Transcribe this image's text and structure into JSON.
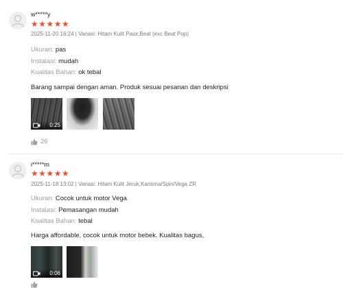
{
  "reviews": [
    {
      "username": "w*****y",
      "stars": "★★★★★",
      "meta": "2025-11-20 16:24 | Variasi: Hitam Kulit Pasir,Beat (exc Beat Pop)",
      "attributes": [
        {
          "key": "Ukuran: ",
          "value": "pas"
        },
        {
          "key": "Instalasi: ",
          "value": "mudah"
        },
        {
          "key": "Kualitas Bahan: ",
          "value": "ok tebal"
        }
      ],
      "comment": "Barang sampai dengan aman. Produk sesuai pesanan dan deskripsi",
      "media": [
        {
          "type": "video",
          "duration": "0:25"
        },
        {
          "type": "image"
        },
        {
          "type": "image"
        }
      ],
      "likes": "26"
    },
    {
      "username": "i*****m",
      "stars": "★★★★★",
      "meta": "2025-11-18 13:02 | Variasi: Hitam Kulit Jeruk,Karisma/Spin/Vega ZR",
      "attributes": [
        {
          "key": "Ukuran: ",
          "value": "Cocok untuk motor Vega"
        },
        {
          "key": "Instalasi: ",
          "value": "Pemasangan mudah"
        },
        {
          "key": "Kualitas Bahan: ",
          "value": "tebal"
        }
      ],
      "comment": "Harga affordable, cocok untuk motor bebek. Kualitas bagus,",
      "media": [
        {
          "type": "video",
          "duration": "0:06"
        },
        {
          "type": "image"
        }
      ]
    }
  ],
  "colors": {
    "star": "#ee4d2d",
    "muted": "#8a8a8a"
  },
  "icons": [
    "avatar-placeholder-icon",
    "video-camera-icon",
    "thumbs-up-icon"
  ]
}
